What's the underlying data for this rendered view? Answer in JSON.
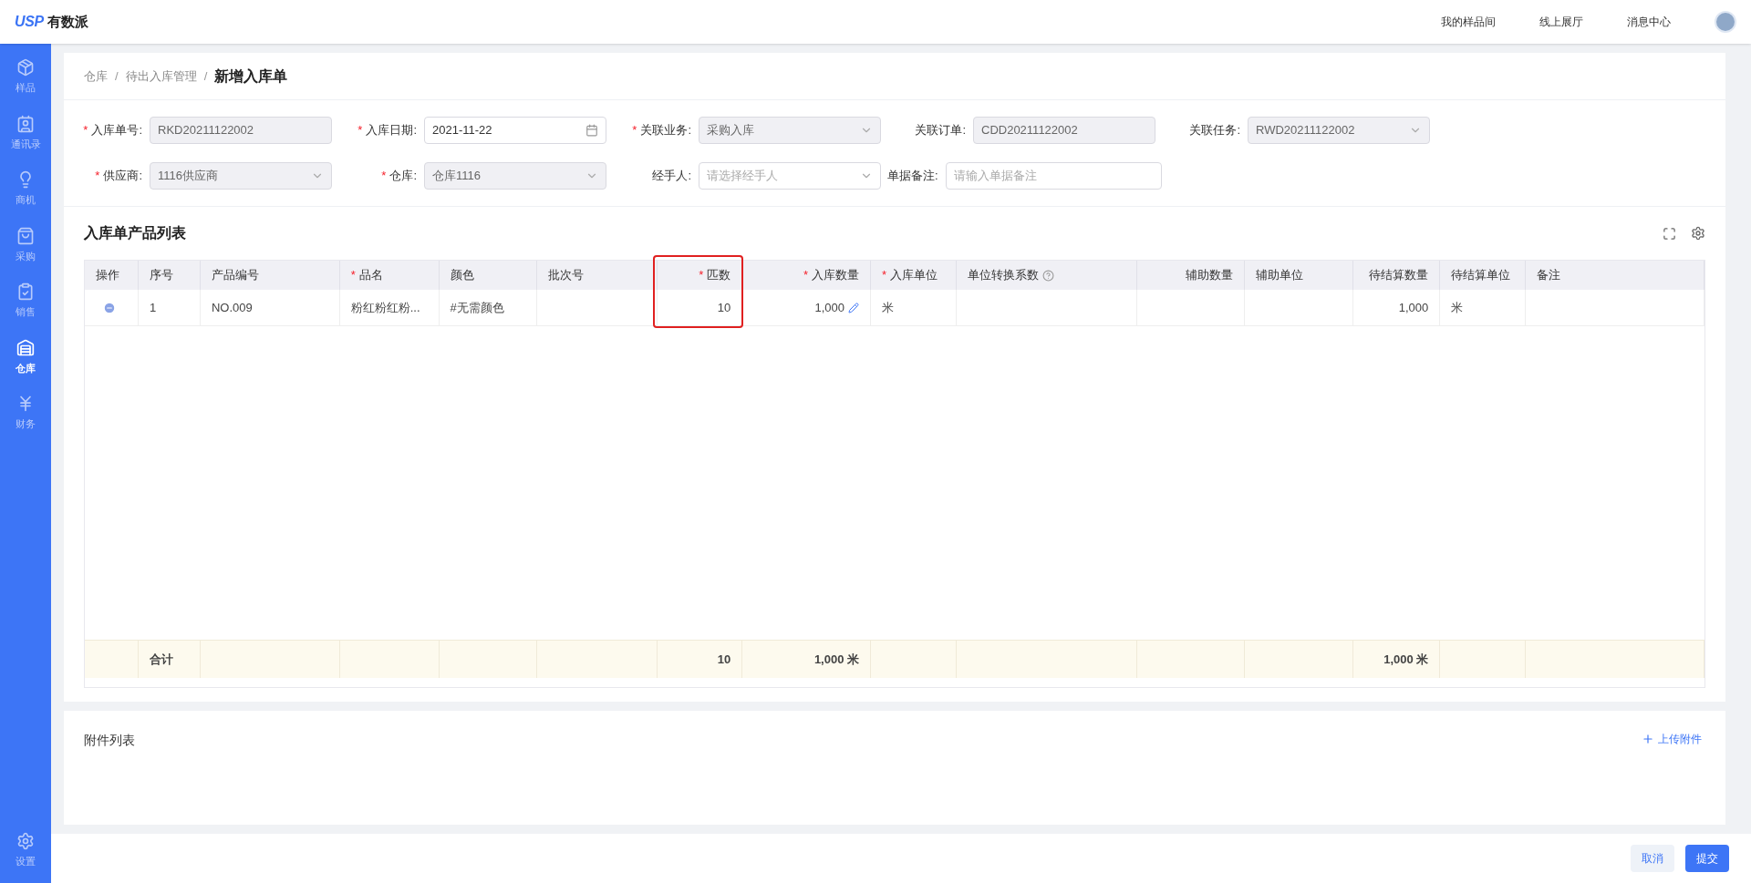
{
  "header": {
    "logo_mark": "USP",
    "logo_text": "有数派",
    "links": [
      "我的样品间",
      "线上展厅",
      "消息中心"
    ]
  },
  "sidebar": {
    "items": [
      {
        "label": "样品",
        "kind": "package",
        "selected": false
      },
      {
        "label": "通讯录",
        "kind": "contact",
        "selected": false
      },
      {
        "label": "商机",
        "kind": "bulb",
        "selected": false
      },
      {
        "label": "采购",
        "kind": "bag",
        "selected": false
      },
      {
        "label": "销售",
        "kind": "clipboard",
        "selected": false
      },
      {
        "label": "仓库",
        "kind": "warehouse",
        "selected": true
      },
      {
        "label": "财务",
        "kind": "money",
        "selected": false
      }
    ],
    "bottom_item": {
      "label": "设置",
      "selected": false
    }
  },
  "breadcrumb": [
    {
      "kind": "link",
      "text": "仓库"
    },
    {
      "kind": "separator",
      "text": "/"
    },
    {
      "kind": "link",
      "text": "待出入库管理"
    },
    {
      "kind": "separator",
      "text": "/"
    },
    {
      "kind": "current",
      "text": "新增入库单"
    }
  ],
  "form": {
    "rows": [
      [
        {
          "mark": "*",
          "label": "入库单号:",
          "kind": "text",
          "value": "RKD20211122002",
          "disabled": true
        },
        {
          "mark": "*",
          "label": "入库日期:",
          "kind": "date",
          "value": "2021-11-22",
          "disabled": false
        },
        {
          "mark": "*",
          "label": "关联业务:",
          "kind": "select",
          "value": "采购入库",
          "disabled": true
        },
        {
          "label": "关联订单:",
          "kind": "text",
          "value": "CDD20211122002",
          "disabled": true
        },
        {
          "label": "关联任务:",
          "kind": "select",
          "value": "RWD20211122002",
          "disabled": true
        }
      ],
      [
        {
          "mark": "*",
          "label": "供应商:",
          "kind": "select",
          "value": "1116供应商",
          "disabled": true
        },
        {
          "mark": "*",
          "label": "仓库:",
          "kind": "select",
          "value": "仓库1116",
          "disabled": true
        },
        {
          "label": "经手人:",
          "kind": "select",
          "placeholder": "请选择经手人",
          "disabled": false
        },
        {
          "label": "单据备注:",
          "kind": "wide",
          "placeholder": "请输入单据备注",
          "disabled": false
        }
      ]
    ]
  },
  "table": {
    "title": "入库单产品列表",
    "columns": [
      {
        "label": "操作",
        "right_aligned": false
      },
      {
        "label": "序号",
        "right_aligned": false,
        "total": "合计"
      },
      {
        "label": "产品编号",
        "right_aligned": false
      },
      {
        "mark": "*",
        "label": "品名",
        "right_aligned": false
      },
      {
        "label": "颜色",
        "right_aligned": false
      },
      {
        "label": "批次号",
        "right_aligned": false
      },
      {
        "mark": "*",
        "label": "匹数",
        "right_aligned": true,
        "highlighted": true,
        "total": "10"
      },
      {
        "mark": "*",
        "label": "入库数量",
        "right_aligned": true,
        "editable": true,
        "total": "1,000 米"
      },
      {
        "mark": "*",
        "label": "入库单位",
        "right_aligned": false
      },
      {
        "label": "单位转换系数",
        "right_aligned": false,
        "help": true
      },
      {
        "label": "辅助数量",
        "right_aligned": true
      },
      {
        "label": "辅助单位",
        "right_aligned": false
      },
      {
        "label": "待结算数量",
        "right_aligned": true,
        "total": "1,000 米"
      },
      {
        "label": "待结算单位",
        "right_aligned": false
      },
      {
        "label": "备注",
        "right_aligned": false
      }
    ],
    "rows": [
      {
        "cells": [
          {},
          {
            "text": "1"
          },
          {
            "text": "NO.009"
          },
          {
            "text": "粉红粉红粉..."
          },
          {
            "text": "#无需颜色"
          },
          {},
          {
            "text": "10"
          },
          {
            "text": "1,000"
          },
          {
            "text": "米"
          },
          {},
          {},
          {},
          {
            "text": "1,000"
          },
          {
            "text": "米"
          },
          {}
        ]
      }
    ]
  },
  "attachments": {
    "title": "附件列表",
    "upload": "上传附件"
  },
  "footer": {
    "buttons": [
      {
        "label": "取消",
        "kind": "secondary"
      },
      {
        "label": "提交",
        "kind": "primary"
      }
    ]
  }
}
